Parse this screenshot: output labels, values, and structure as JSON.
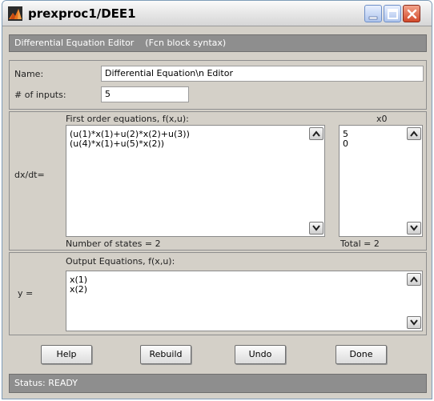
{
  "window": {
    "title": "prexproc1/DEE1"
  },
  "header": {
    "text": "Differential Equation Editor    (Fcn block syntax)"
  },
  "name": {
    "label": "Name:",
    "value": "Differential Equation\\n Editor"
  },
  "inputs": {
    "label": "# of inputs:",
    "value": "5"
  },
  "dxdt": {
    "side_label": "dx/dt=",
    "title": "First order equations, f(x,u):",
    "equations": [
      "(u(1)*x(1)+u(2)*x(2)+u(3))",
      "(u(4)*x(1)+u(5)*x(2))"
    ],
    "state_count": "Number of states = 2"
  },
  "x0": {
    "title": "x0",
    "values": [
      "5",
      "0"
    ],
    "total": "Total = 2"
  },
  "output": {
    "side_label": "y =",
    "title": "Output Equations, f(x,u):",
    "equations": [
      "x(1)",
      "x(2)"
    ]
  },
  "buttons": {
    "help": "Help",
    "rebuild": "Rebuild",
    "undo": "Undo",
    "done": "Done"
  },
  "status": {
    "text": "Status: READY"
  },
  "icons": [
    "app-icon",
    "minimize-icon",
    "maximize-icon",
    "close-icon",
    "scroll-up-icon",
    "scroll-down-icon"
  ]
}
